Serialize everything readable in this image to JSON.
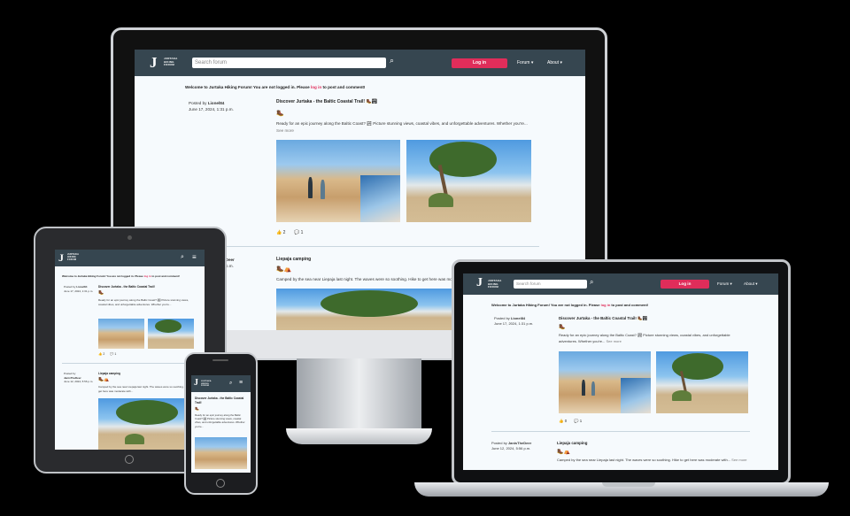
{
  "brand": {
    "logo_letter": "J",
    "name_lines": [
      "JURTAKA",
      "HIKING",
      "FORUM"
    ]
  },
  "nav": {
    "search_placeholder": "Search forum",
    "login": "Log in",
    "forum": "Forum",
    "about": "About"
  },
  "welcome": {
    "prefix": "Welcome to Jurtaka Hiking Forum! You are not logged in. Please ",
    "link": "log in",
    "suffix": " to post and comment!"
  },
  "posts": [
    {
      "posted_by": "Posted by",
      "author": "Lionel84",
      "date": "June 17, 2024, 1:31 p.m.",
      "title": "Discover Jurtaka - the Baltic Coastal Trail!",
      "emoji": "🥾🏞",
      "icons": "🥾",
      "body": "Ready for an epic journey along the Baltic Coast? 🏞 Picture stunning views, coastal vibes, and unforgettable adventures. Whether you're...",
      "see_more": "See more",
      "likes": "2",
      "comments": "1"
    },
    {
      "posted_by": "Posted by",
      "author": "JanisTheDeer",
      "date": "June 12, 2024, 5:56 p.m.",
      "title": "Liepaja camping",
      "emoji": "",
      "icons": "🥾⛺",
      "body": "Camped by the sea near Liepaja last night. The waves were so soothing. Hike to get here was moderate with...",
      "see_more": "See more",
      "likes": "",
      "comments": ""
    }
  ],
  "laptop_likes": "0",
  "colors": {
    "navbar": "#364650",
    "accent": "#e02d5a",
    "page_bg": "#f6fafd"
  }
}
